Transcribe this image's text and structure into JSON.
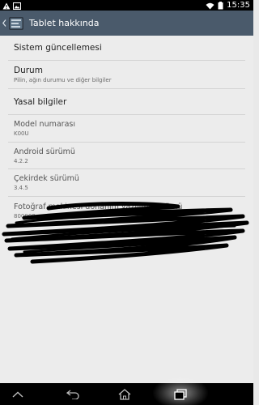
{
  "status_bar": {
    "time": "15:35",
    "icons": [
      "warning-icon",
      "image-notification-icon",
      "wifi-icon",
      "battery-icon"
    ]
  },
  "action_bar": {
    "title": "Tablet hakkında",
    "icon": "settings-app-icon",
    "color": "#4a5a6b"
  },
  "items": [
    {
      "title": "Sistem güncellemesi",
      "subtitle": ""
    },
    {
      "title": "Durum",
      "subtitle": "Pilin, ağın durumu ve diğer bilgiler"
    },
    {
      "title": "Yasal bilgiler",
      "subtitle": ""
    },
    {
      "title": "Model numarası",
      "subtitle": "K00U"
    },
    {
      "title": "Android sürümü",
      "subtitle": "4.2.2"
    },
    {
      "title": "Çekirdek sürümü",
      "subtitle": "3.4.5"
    },
    {
      "title": "Fotoğraf makinesi donanım yazılımı sürümü",
      "subtitle": "800000"
    }
  ],
  "nav_bar": {
    "buttons": [
      "up-chevron-icon",
      "back-icon",
      "home-icon",
      "recent-apps-icon"
    ]
  }
}
